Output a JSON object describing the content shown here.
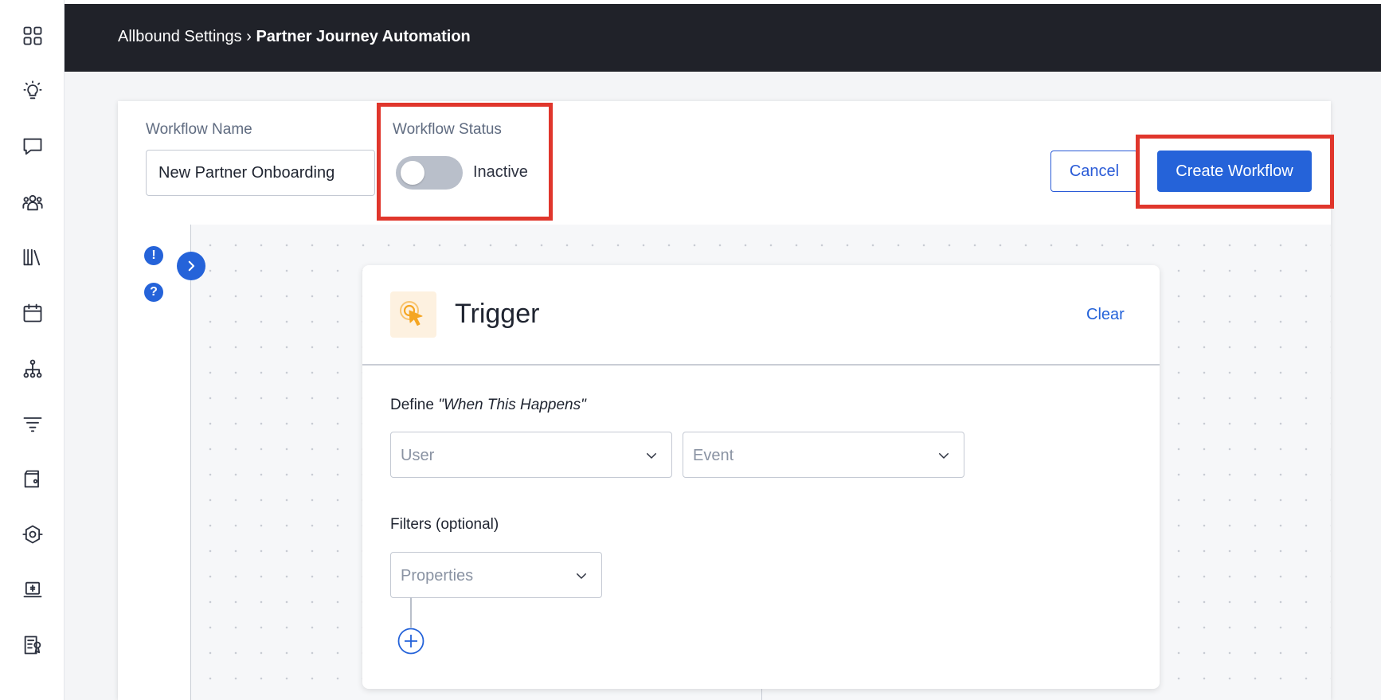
{
  "header": {
    "breadcrumb_parent": "Allbound Settings",
    "breadcrumb_separator": "›",
    "breadcrumb_current": "Partner Journey Automation"
  },
  "sidebar": {
    "items": [
      {
        "icon": "dashboard-grid-icon"
      },
      {
        "icon": "lightbulb-icon"
      },
      {
        "icon": "chat-bubble-icon"
      },
      {
        "icon": "people-group-icon"
      },
      {
        "icon": "library-icon"
      },
      {
        "icon": "calendar-icon"
      },
      {
        "icon": "org-chart-icon"
      },
      {
        "icon": "filter-funnel-icon"
      },
      {
        "icon": "wallet-icon"
      },
      {
        "icon": "integration-icon"
      },
      {
        "icon": "laptop-dollar-icon"
      },
      {
        "icon": "certificate-icon"
      }
    ]
  },
  "form": {
    "name_label": "Workflow Name",
    "name_value": "New Partner Onboarding",
    "status_label": "Workflow Status",
    "status_value": "Inactive",
    "status_on": false,
    "cancel_label": "Cancel",
    "create_label": "Create Workflow"
  },
  "canvas": {
    "alert_icon_text": "!",
    "help_icon_text": "?"
  },
  "trigger": {
    "title": "Trigger",
    "clear_label": "Clear",
    "define_prefix": "Define ",
    "define_emphasis": "\"When This Happens\"",
    "user_placeholder": "User",
    "event_placeholder": "Event",
    "filters_label": "Filters (optional)",
    "properties_placeholder": "Properties"
  },
  "colors": {
    "accent": "#2563d9",
    "highlight": "#e0362c",
    "header_bg": "#202229",
    "trigger_icon": "#f5a623"
  }
}
